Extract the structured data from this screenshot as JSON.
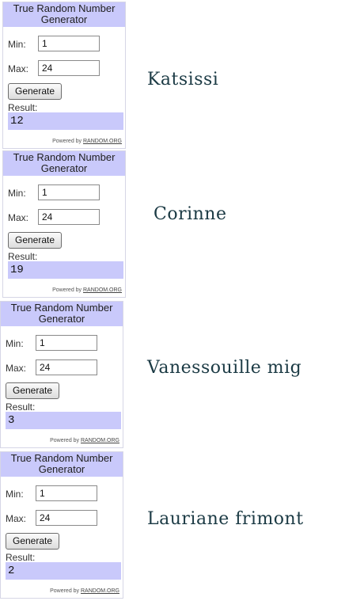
{
  "widget_title": "True Random Number Generator",
  "min_label": "Min:",
  "max_label": "Max:",
  "generate_label": "Generate",
  "result_label": "Result:",
  "powered_by": "Powered by",
  "powered_org": "RANDOM.ORG",
  "draws": [
    {
      "min": "1",
      "max": "24",
      "result": "12",
      "name": "Katsissi"
    },
    {
      "min": "1",
      "max": "24",
      "result": "19",
      "name": "Corinne"
    },
    {
      "min": "1",
      "max": "24",
      "result": "3",
      "name": "Vanessouille mig"
    },
    {
      "min": "1",
      "max": "24",
      "result": "2",
      "name": "Lauriane frimont"
    }
  ]
}
